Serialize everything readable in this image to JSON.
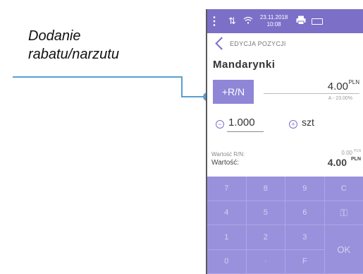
{
  "annotation": {
    "line1": "Dodanie",
    "line2": "rabatu/narzutu"
  },
  "statusbar": {
    "menu_icon": "⋮",
    "transfer_icon": "⇅",
    "wifi_icon": "wifi",
    "date": "23.11.2018",
    "time": "10:08",
    "printer_icon": "printer",
    "battery_icon": "battery"
  },
  "header": {
    "title": "EDYCJA POZYCJI"
  },
  "product": {
    "name": "Mandarynki"
  },
  "discount": {
    "button_label": "+R/N",
    "price": "4.00",
    "price_unit": "PLN",
    "vat": "A - 23.00%"
  },
  "quantity": {
    "minus": "−",
    "value": "1.000",
    "plus": "+",
    "unit": "szt"
  },
  "summary": {
    "rn_label": "Wartość R/N:",
    "rn_value": "0.00",
    "rn_unit": "PLN",
    "total_label": "Wartość:",
    "total_value": "4.00",
    "total_unit": "PLN"
  },
  "keypad": {
    "k7": "7",
    "k8": "8",
    "k9": "9",
    "kC": "C",
    "k4": "4",
    "k5": "5",
    "k6": "6",
    "kKey": "⚿",
    "k1": "1",
    "k2": "2",
    "k3": "3",
    "kOK": "OK",
    "k0": "0",
    "kDot": "·",
    "kF": "F"
  }
}
